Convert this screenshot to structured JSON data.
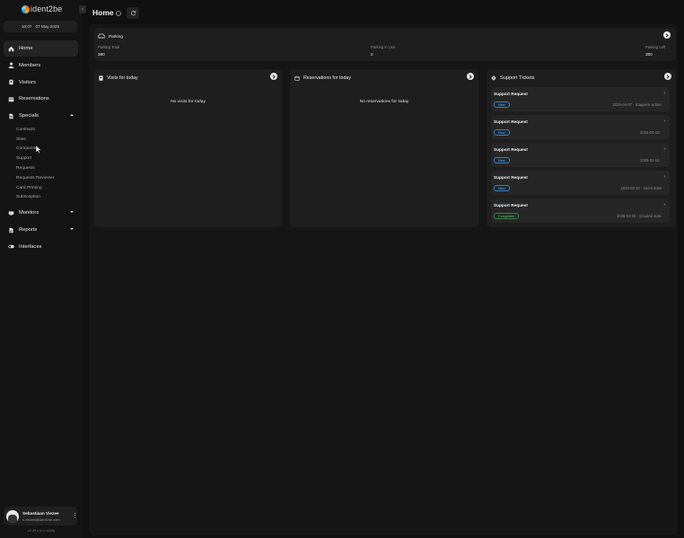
{
  "app": {
    "logo_text": "ident2be"
  },
  "datetime": {
    "time": "10:07",
    "date": "07 May 2025"
  },
  "sidebar": {
    "items": [
      {
        "label": "Home",
        "icon": "home-icon"
      },
      {
        "label": "Members",
        "icon": "user-icon"
      },
      {
        "label": "Visitors",
        "icon": "badge-icon"
      },
      {
        "label": "Reservations",
        "icon": "calendar-icon"
      },
      {
        "label": "Specials",
        "icon": "document-icon",
        "expanded": true
      },
      {
        "label": "Monitors",
        "icon": "monitor-icon"
      },
      {
        "label": "Reports",
        "icon": "report-icon"
      },
      {
        "label": "Interfaces",
        "icon": "toggle-icon"
      }
    ],
    "specials_sub": [
      "Contracts",
      "Sites",
      "Companies",
      "Support",
      "Requests",
      "Requests Reviewer",
      "Card Printing",
      "Subscription"
    ]
  },
  "user": {
    "name": "Sebastiaan Viezee",
    "email": "s.viezee@ident2be.com"
  },
  "version": "v2.29.x (c.0.1059)",
  "header": {
    "title": "Home",
    "info_glyph": "i"
  },
  "parking": {
    "title": "Parking",
    "stats": [
      {
        "label": "Parking Total",
        "value": "380"
      },
      {
        "label": "Parking in Use",
        "value": "0"
      },
      {
        "label": "Parking Left",
        "value": "380"
      }
    ]
  },
  "visits": {
    "title": "Visits for today",
    "empty": "No visits for today"
  },
  "reservations": {
    "title": "Reservations for today",
    "empty": "No reservations for today"
  },
  "tickets": {
    "title": "Support Tickets",
    "items": [
      {
        "title": "Support Request",
        "status": "New",
        "status_type": "new",
        "meta": "2025-04-07 · Stagiaire achter"
      },
      {
        "title": "Support Request",
        "status": "New",
        "status_type": "new",
        "meta": "2025-03-18 ·"
      },
      {
        "title": "Support Request",
        "status": "New",
        "status_type": "new",
        "meta": "2025-03-18 ·"
      },
      {
        "title": "Support Request",
        "status": "New",
        "status_type": "new",
        "meta": "2025-03-10 · Vacht suite"
      },
      {
        "title": "Support Request",
        "status": "Completed",
        "status_type": "completed",
        "meta": "2025-03-06 · Gouded suite"
      }
    ]
  },
  "colors": {
    "background": "#101010",
    "card": "#1e1e1e",
    "new_badge": "#6fb0ea",
    "completed_badge": "#6cc07c"
  }
}
